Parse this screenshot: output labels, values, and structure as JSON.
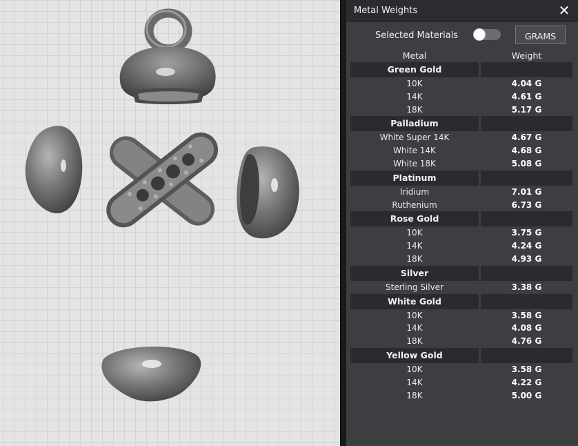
{
  "panel": {
    "title": "Metal Weights",
    "close_icon": "close-icon",
    "selected_materials_label": "Selected Materials",
    "toggle_state": "off",
    "unit_button_label": "GRAMS",
    "columns": {
      "metal": "Metal",
      "weight": "Weight"
    }
  },
  "groups": [
    {
      "name": "Green Gold",
      "items": [
        {
          "name": "10K",
          "weight": "4.04 G"
        },
        {
          "name": "14K",
          "weight": "4.61 G"
        },
        {
          "name": "18K",
          "weight": "5.17 G"
        }
      ]
    },
    {
      "name": "Palladium",
      "items": [
        {
          "name": "White Super 14K",
          "weight": "4.67 G"
        },
        {
          "name": "White 14K",
          "weight": "4.68 G"
        },
        {
          "name": "White 18K",
          "weight": "5.08 G"
        }
      ]
    },
    {
      "name": "Platinum",
      "items": [
        {
          "name": "Iridium",
          "weight": "7.01 G"
        },
        {
          "name": "Ruthenium",
          "weight": "6.73 G"
        }
      ]
    },
    {
      "name": "Rose Gold",
      "items": [
        {
          "name": "10K",
          "weight": "3.75 G"
        },
        {
          "name": "14K",
          "weight": "4.24 G"
        },
        {
          "name": "18K",
          "weight": "4.93 G"
        }
      ]
    },
    {
      "name": "Silver",
      "items": [
        {
          "name": "Sterling Silver",
          "weight": "3.38 G"
        }
      ]
    },
    {
      "name": "White Gold",
      "items": [
        {
          "name": "10K",
          "weight": "3.58 G"
        },
        {
          "name": "14K",
          "weight": "4.08 G"
        },
        {
          "name": "18K",
          "weight": "4.76 G"
        }
      ]
    },
    {
      "name": "Yellow Gold",
      "items": [
        {
          "name": "10K",
          "weight": "3.58 G"
        },
        {
          "name": "14K",
          "weight": "4.22 G"
        },
        {
          "name": "18K",
          "weight": "5.00 G"
        }
      ]
    }
  ],
  "colors": {
    "panel_bg": "#3d3e42",
    "header_bg": "#2b2c30",
    "group_bg": "#2a2b2f",
    "viewport_bg": "#e4e4e4",
    "model_gray": "#6e6e6e"
  }
}
